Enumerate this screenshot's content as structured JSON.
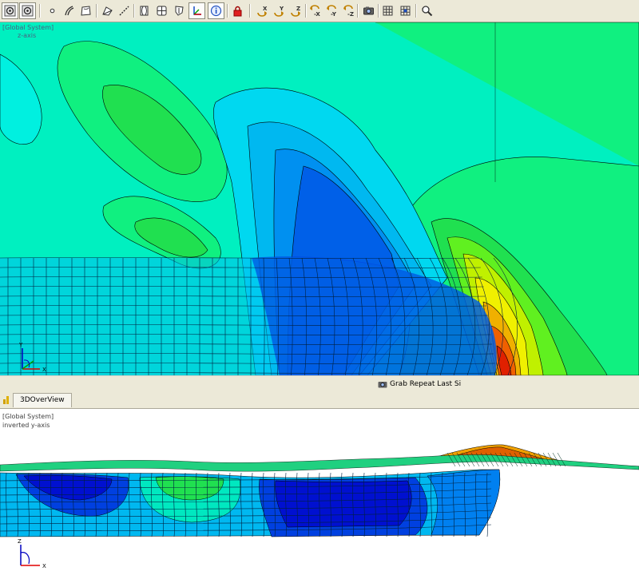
{
  "toolbar": {
    "buttons": [
      {
        "name": "view-target-button",
        "icon": "target-circle-icon",
        "pressed": false
      },
      {
        "name": "view-center-button",
        "icon": "target-circle-icon",
        "pressed": true
      },
      {
        "name": "node-button",
        "icon": "dot-icon",
        "pressed": false
      },
      {
        "name": "edge-button",
        "icon": "curve-icon",
        "pressed": false
      },
      {
        "name": "face-button",
        "icon": "surface-icon",
        "pressed": false
      },
      {
        "name": "polygon-button",
        "icon": "polygon-icon",
        "pressed": false
      },
      {
        "name": "dashed-line-button",
        "icon": "dashed-line-icon",
        "pressed": false
      },
      {
        "name": "shell-button",
        "icon": "shell-icon",
        "pressed": false
      },
      {
        "name": "grid-box-button",
        "icon": "grid-box-icon",
        "pressed": false
      },
      {
        "name": "shield-button",
        "icon": "shield-icon",
        "pressed": false
      },
      {
        "name": "triad-button",
        "icon": "triad-icon",
        "pressed": true
      },
      {
        "name": "info-button",
        "icon": "info-icon",
        "pressed": true
      },
      {
        "name": "lock-button",
        "icon": "lock-icon",
        "pressed": false
      },
      {
        "name": "rotate-x-button",
        "icon": "rotate-x-icon",
        "label": "X",
        "pressed": false
      },
      {
        "name": "rotate-y-button",
        "icon": "rotate-y-icon",
        "label": "Y",
        "pressed": false
      },
      {
        "name": "rotate-z-button",
        "icon": "rotate-z-icon",
        "label": "Z",
        "pressed": false
      },
      {
        "name": "rotate-neg-x-button",
        "icon": "rotate-neg-x-icon",
        "label": "-X",
        "pressed": false
      },
      {
        "name": "rotate-neg-y-button",
        "icon": "rotate-neg-y-icon",
        "label": "-Y",
        "pressed": false
      },
      {
        "name": "rotate-neg-z-button",
        "icon": "rotate-neg-z-icon",
        "label": "-Z",
        "pressed": false
      },
      {
        "name": "camera-button",
        "icon": "camera-icon",
        "pressed": false
      },
      {
        "name": "grid-button",
        "icon": "grid-icon",
        "pressed": false
      },
      {
        "name": "grid-snap-button",
        "icon": "grid-snap-icon",
        "pressed": false
      },
      {
        "name": "zoom-button",
        "icon": "magnifier-icon",
        "pressed": false
      }
    ]
  },
  "upper_view": {
    "system_label": "[Global System]",
    "axis_label": "z-axis",
    "triad": {
      "vertical": "Y",
      "horizontal": "X"
    }
  },
  "status": {
    "grab_label": "Grab Repeat Last Si",
    "grab_icon": "camera-icon"
  },
  "lower_panel": {
    "tab_label": "3DOverView",
    "tab_icon": "bar-chart-icon",
    "system_label": "[Global System]",
    "axis_label": "inverted y-axis",
    "triad": {
      "vertical": "Z",
      "horizontal": "X"
    }
  },
  "colors": {
    "toolbar_bg": "#ece9d8",
    "contour_low": "#0000e0",
    "contour_mid": "#00f0c0",
    "contour_high": "#e02000",
    "label_blue": "#4a6080",
    "label_gray": "#404040",
    "axis_red": "#e00000",
    "axis_blue": "#0000c0"
  }
}
